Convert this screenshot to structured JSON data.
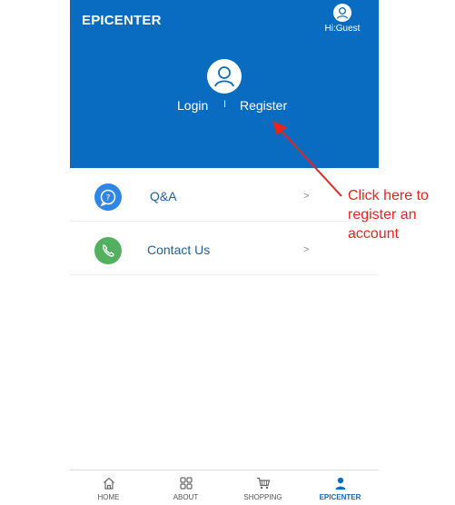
{
  "header": {
    "title": "EPICENTER",
    "guest_label": "Hi:Guest"
  },
  "hero": {
    "login_label": "Login",
    "separator": "I",
    "register_label": "Register"
  },
  "menu": {
    "items": [
      {
        "label": "Q&A",
        "icon": "chat-question-icon",
        "arrow": ">",
        "color": "#2f86e6"
      },
      {
        "label": "Contact Us",
        "icon": "phone-icon",
        "arrow": ">",
        "color": "#52b060"
      }
    ]
  },
  "tabs": [
    {
      "label": "HOME",
      "icon": "home-icon"
    },
    {
      "label": "ABOUT",
      "icon": "grid-icon"
    },
    {
      "label": "SHOPPING",
      "icon": "cart-icon"
    },
    {
      "label": "EPICENTER",
      "icon": "person-icon",
      "active": true
    }
  ],
  "annotation": {
    "text": "Click here to register an account",
    "color": "#e8231c"
  },
  "colors": {
    "brand_blue": "#0a6cc0",
    "label_blue": "#1a5f9e"
  }
}
